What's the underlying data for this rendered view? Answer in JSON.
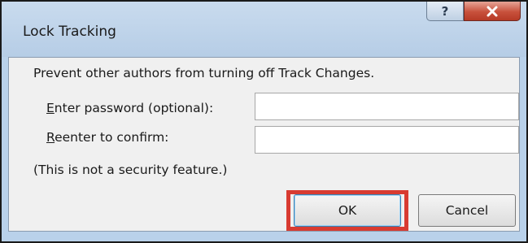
{
  "dialog": {
    "title": "Lock Tracking",
    "help_glyph": "?",
    "description": "Prevent other authors from turning off Track Changes.",
    "password": {
      "label_mnemonic": "E",
      "label_rest": "nter password (optional):",
      "value": ""
    },
    "confirm": {
      "label_mnemonic": "R",
      "label_rest": "eenter to confirm:",
      "value": ""
    },
    "note": "(This is not a security feature.)",
    "ok_label": "OK",
    "cancel_label": "Cancel"
  },
  "colors": {
    "title_bar": "#b9d1ea",
    "close_button": "#c8513c",
    "highlight": "#d83b31",
    "client_area": "#f0f0f0"
  },
  "icons": {
    "help": "help-icon",
    "close": "close-icon"
  }
}
